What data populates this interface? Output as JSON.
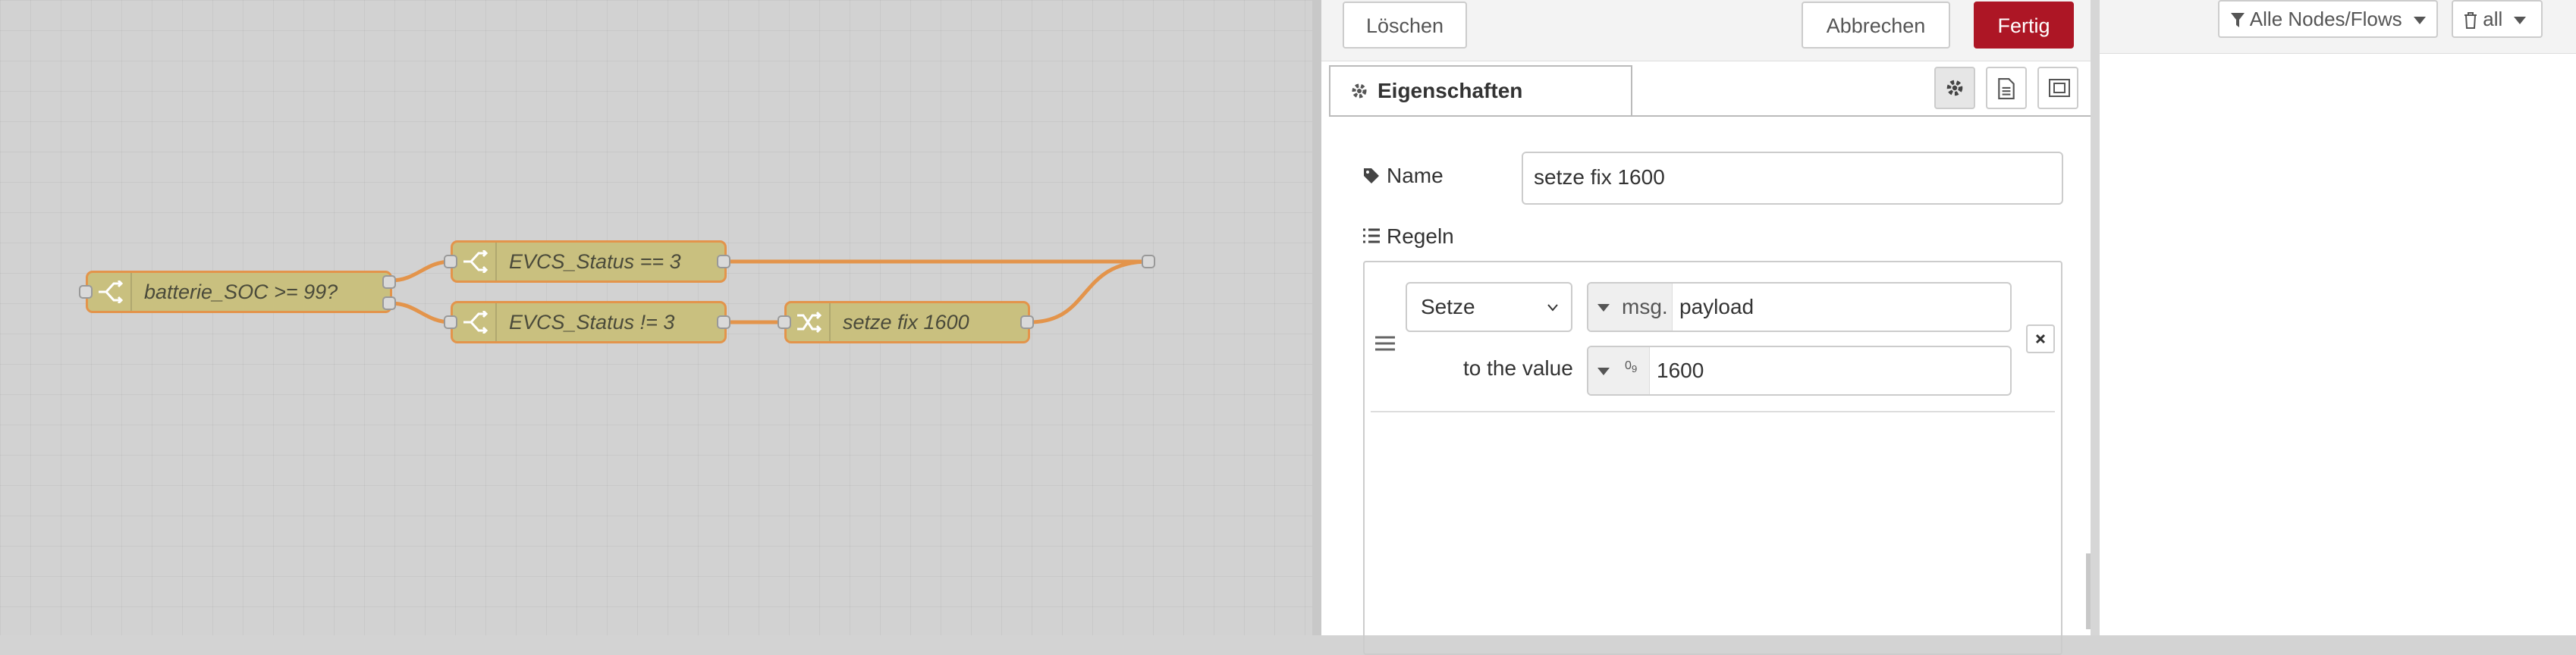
{
  "flow": {
    "nodes": [
      {
        "label": "batterie_SOC >= 99?",
        "type": "switch"
      },
      {
        "label": "EVCS_Status == 3",
        "type": "switch"
      },
      {
        "label": "EVCS_Status != 3",
        "type": "switch"
      },
      {
        "label": "setze fix 1600",
        "type": "change"
      }
    ]
  },
  "editor": {
    "toolbar": {
      "delete_label": "Löschen",
      "cancel_label": "Abbrechen",
      "done_label": "Fertig"
    },
    "tab_label": "Eigenschaften",
    "name_label": "Name",
    "name_value": "setze fix 1600",
    "rules_label": "Regeln",
    "rule": {
      "action": "Setze",
      "target_prefix": "msg.",
      "target_value": "payload",
      "to_label": "to the value",
      "value_type_glyph": "0",
      "value_type_sub": "9",
      "value": "1600"
    }
  },
  "sidebar": {
    "filter_label": "Alle Nodes/Flows",
    "scope_label": "all"
  },
  "colors": {
    "accent": "#ad1625",
    "wire": "#e3944b",
    "node_fill": "#c9c07f"
  }
}
